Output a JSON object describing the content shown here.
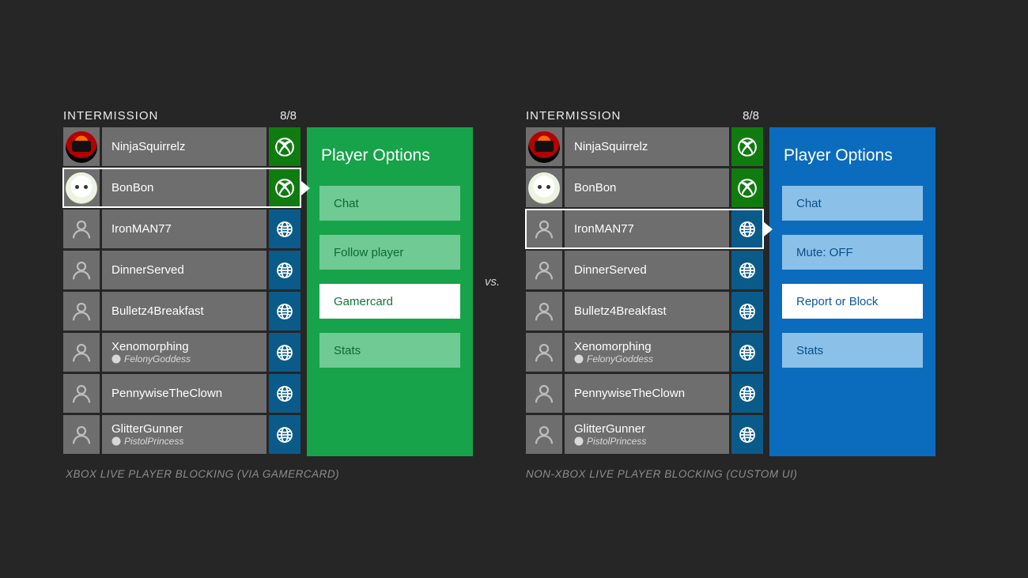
{
  "vs_label": "vs.",
  "left": {
    "header_title": "INTERMISSION",
    "header_count": "8/8",
    "caption": "XBOX LIVE PLAYER BLOCKING (VIA GAMERCARD)",
    "options_title": "Player Options",
    "selected_index": 1,
    "accent": "green",
    "options": [
      {
        "label": "Chat",
        "selected": false
      },
      {
        "label": "Follow player",
        "selected": false
      },
      {
        "label": "Gamercard",
        "selected": true
      },
      {
        "label": "Stats",
        "selected": false
      }
    ],
    "players": [
      {
        "name": "NinjaSquirrelz",
        "network": "xbox",
        "avatar": "ninja"
      },
      {
        "name": "BonBon",
        "network": "xbox",
        "avatar": "bonbon"
      },
      {
        "name": "IronMAN77",
        "network": "web",
        "avatar": "generic"
      },
      {
        "name": "DinnerServed",
        "network": "web",
        "avatar": "generic"
      },
      {
        "name": "Bulletz4Breakfast",
        "network": "web",
        "avatar": "generic"
      },
      {
        "name": "Xenomorphing",
        "sub": "FelonyGoddess",
        "sub_icon": "xbox",
        "network": "web",
        "avatar": "generic"
      },
      {
        "name": "PennywiseTheClown",
        "network": "web",
        "avatar": "generic"
      },
      {
        "name": "GlitterGunner",
        "sub": "PistolPrincess",
        "sub_icon": "xbox",
        "network": "web",
        "avatar": "generic"
      }
    ]
  },
  "right": {
    "header_title": "INTERMISSION",
    "header_count": "8/8",
    "caption": "NON-XBOX LIVE PLAYER BLOCKING (CUSTOM UI)",
    "options_title": "Player Options",
    "selected_index": 2,
    "accent": "blue",
    "options": [
      {
        "label": "Chat",
        "selected": false
      },
      {
        "label": "Mute: OFF",
        "selected": false
      },
      {
        "label": "Report or Block",
        "selected": true
      },
      {
        "label": "Stats",
        "selected": false
      }
    ],
    "players": [
      {
        "name": "NinjaSquirrelz",
        "network": "xbox",
        "avatar": "ninja"
      },
      {
        "name": "BonBon",
        "network": "xbox",
        "avatar": "bonbon"
      },
      {
        "name": "IronMAN77",
        "network": "web",
        "avatar": "generic"
      },
      {
        "name": "DinnerServed",
        "network": "web",
        "avatar": "generic"
      },
      {
        "name": "Bulletz4Breakfast",
        "network": "web",
        "avatar": "generic"
      },
      {
        "name": "Xenomorphing",
        "sub": "FelonyGoddess",
        "sub_icon": "xbox",
        "network": "web",
        "avatar": "generic"
      },
      {
        "name": "PennywiseTheClown",
        "network": "web",
        "avatar": "generic"
      },
      {
        "name": "GlitterGunner",
        "sub": "PistolPrincess",
        "sub_icon": "xbox",
        "network": "web",
        "avatar": "generic"
      }
    ]
  }
}
